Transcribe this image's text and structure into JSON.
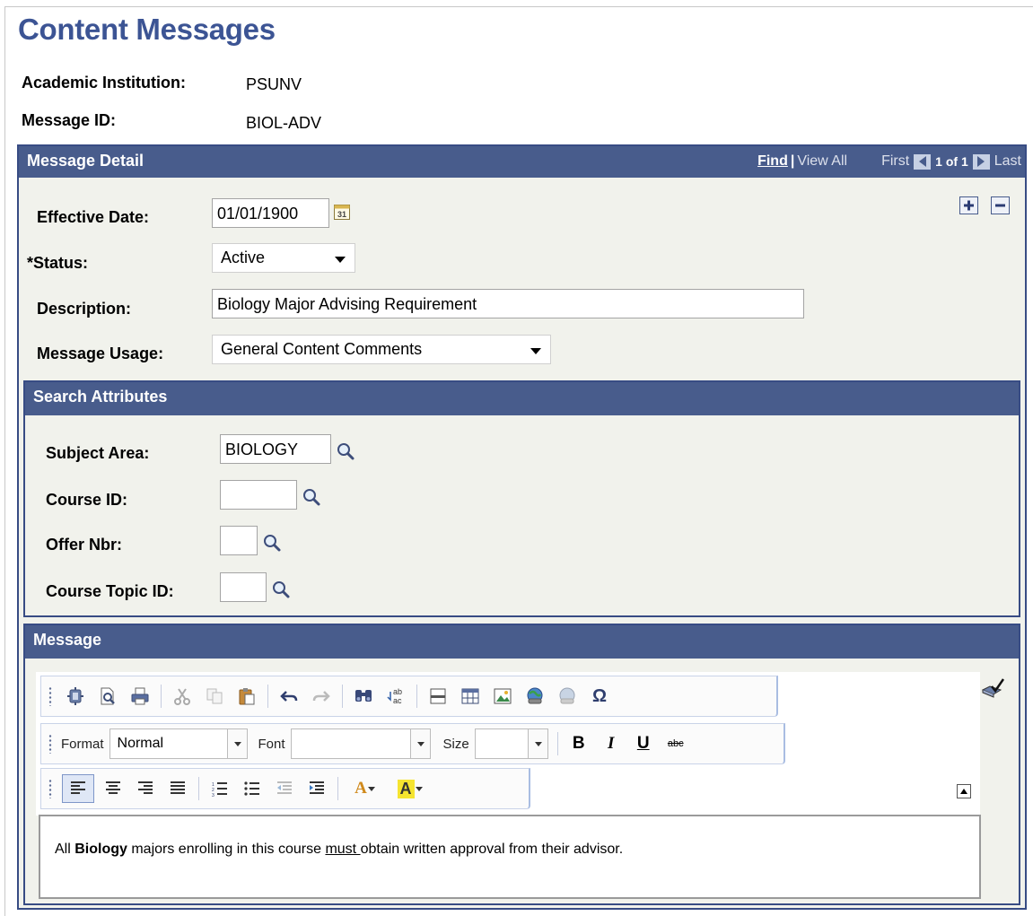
{
  "page": {
    "title": "Content Messages"
  },
  "header": {
    "institution_label": "Academic Institution:",
    "institution_value": "PSUNV",
    "message_id_label": "Message ID:",
    "message_id_value": "BIOL-ADV"
  },
  "message_detail": {
    "bar_title": "Message Detail",
    "nav": {
      "find": "Find",
      "view_all": "View All",
      "first": "First",
      "count": "1 of 1",
      "last": "Last"
    },
    "effective_date_label": "Effective Date:",
    "effective_date_value": "01/01/1900",
    "status_label": "*Status:",
    "status_value": "Active",
    "description_label": "Description:",
    "description_value": "Biology Major Advising Requirement",
    "usage_label": "Message Usage:",
    "usage_value": "General Content Comments"
  },
  "search_attributes": {
    "bar_title": "Search Attributes",
    "subject_area_label": "Subject Area:",
    "subject_area_value": "BIOLOGY",
    "course_id_label": "Course ID:",
    "course_id_value": "",
    "offer_nbr_label": "Offer Nbr:",
    "offer_nbr_value": "",
    "topic_id_label": "Course Topic ID:",
    "topic_id_value": ""
  },
  "message": {
    "bar_title": "Message",
    "toolbar": {
      "format_label": "Format",
      "format_value": "Normal",
      "font_label": "Font",
      "font_value": "",
      "size_label": "Size",
      "size_value": "",
      "bold": "B",
      "italic": "I",
      "underline": "U",
      "strike": "abc",
      "special_char": "Ω",
      "text_color": "A",
      "bg_color": "A"
    },
    "body": {
      "part1": "All ",
      "part2": "Biology",
      "part3": " majors enrolling in this course ",
      "part4": "must ",
      "part5": "obtain written approval from their advisor."
    }
  },
  "colors": {
    "title": "#3c5494",
    "section_bar": "#485c8c",
    "section_bg": "#f1f2ec"
  }
}
